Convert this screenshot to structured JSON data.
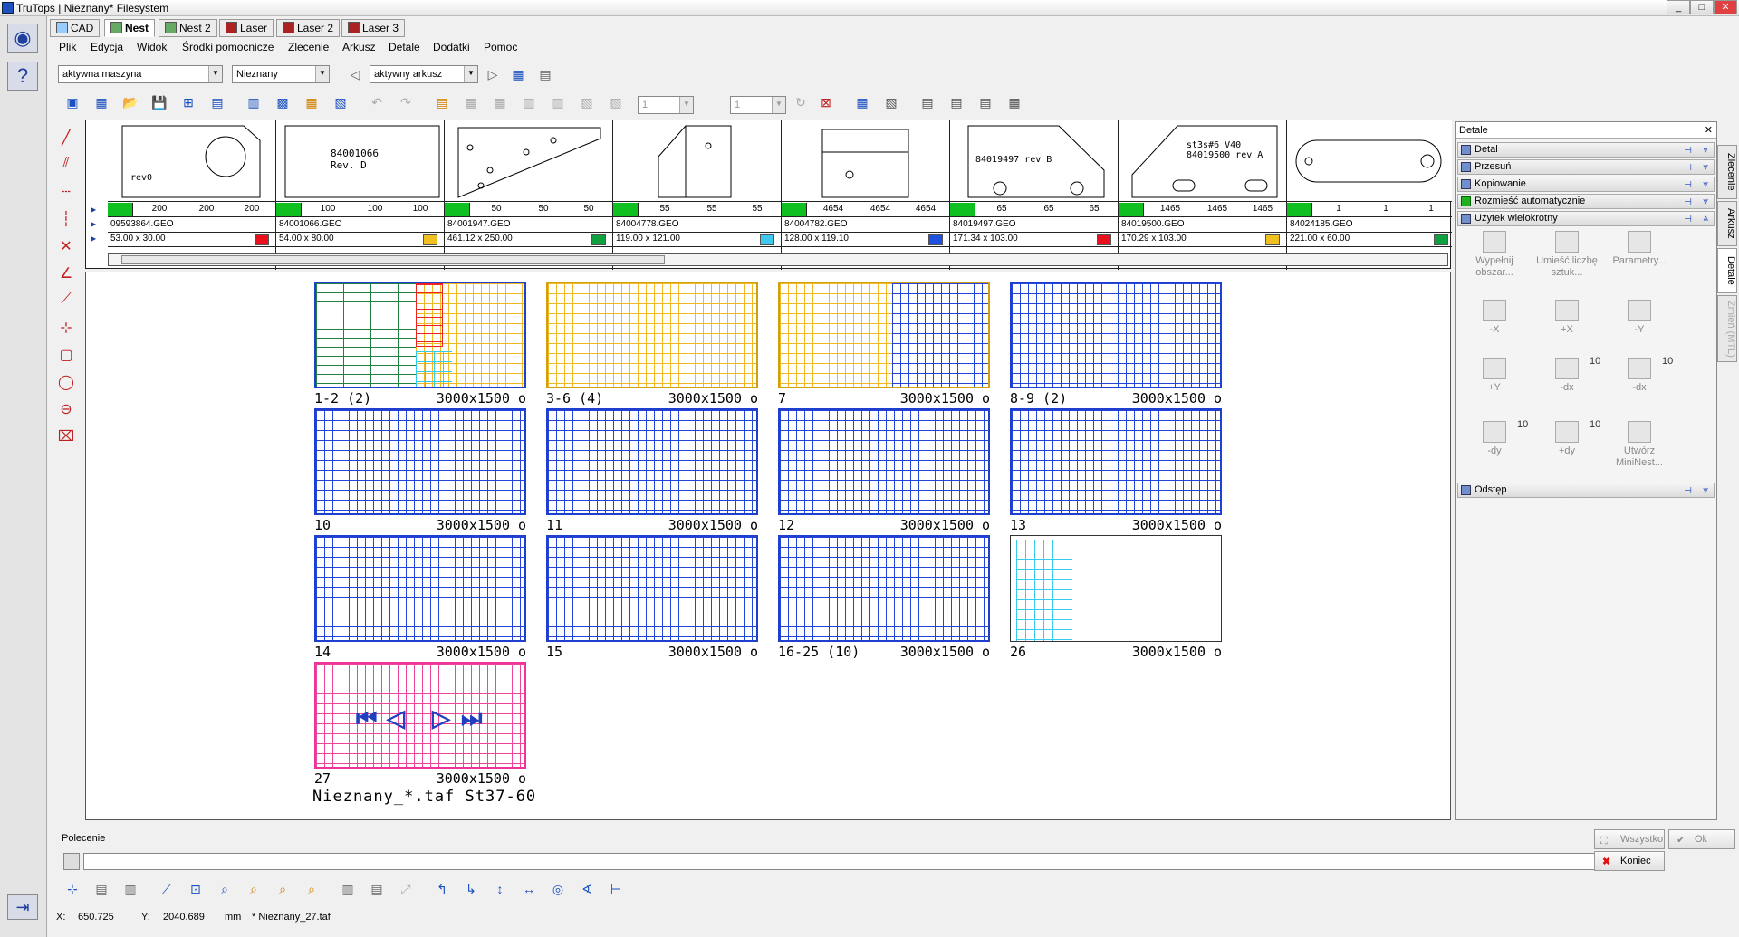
{
  "window": {
    "title": "TruTops | Nieznany*  Filesystem",
    "min": "_",
    "max": "□",
    "close": "✕"
  },
  "tabs": [
    {
      "label": "CAD"
    },
    {
      "label": "Nest"
    },
    {
      "label": "Nest 2"
    },
    {
      "label": "Laser"
    },
    {
      "label": "Laser 2"
    },
    {
      "label": "Laser 3"
    }
  ],
  "menu": [
    "Plik",
    "Edycja",
    "Widok",
    "Środki pomocnicze",
    "Zlecenie",
    "Arkusz",
    "Detale",
    "Dodatki",
    "Pomoc"
  ],
  "combos": {
    "machine": "aktywna maszyna",
    "material": "Nieznany",
    "sheet": "aktywny arkusz",
    "spin1": "1",
    "spin2": "1"
  },
  "parts": [
    {
      "file": "09593864.GEO",
      "dim": "53.00 x 30.00",
      "q": [
        "200",
        "200",
        "200"
      ],
      "color": "#e8101a",
      "text": "rev0"
    },
    {
      "file": "84001066.GEO",
      "dim": "54.00 x 80.00",
      "q": [
        "100",
        "100",
        "100"
      ],
      "color": "#f0c020",
      "text": "84001066 Rev. D"
    },
    {
      "file": "84001947.GEO",
      "dim": "461.12 x 250.00",
      "q": [
        "50",
        "50",
        "50"
      ],
      "color": "#10a040",
      "text": ""
    },
    {
      "file": "84004778.GEO",
      "dim": "119.00 x 121.00",
      "q": [
        "55",
        "55",
        "55"
      ],
      "color": "#40c8f0",
      "text": ""
    },
    {
      "file": "84004782.GEO",
      "dim": "128.00 x 119.10",
      "q": [
        "4654",
        "4654",
        "4654"
      ],
      "color": "#2050e0",
      "text": ""
    },
    {
      "file": "84019497.GEO",
      "dim": "171.34 x 103.00",
      "q": [
        "65",
        "65",
        "65"
      ],
      "color": "#e8101a",
      "text": "84019497 rev B"
    },
    {
      "file": "84019500.GEO",
      "dim": "170.29 x 103.00",
      "q": [
        "1465",
        "1465",
        "1465"
      ],
      "color": "#f0c020",
      "text": "st3s#6 V40  84019500 rev A"
    },
    {
      "file": "84024185.GEO",
      "dim": "221.00 x 60.00",
      "q": [
        "1",
        "1",
        "1"
      ],
      "color": "#10a040",
      "text": ""
    }
  ],
  "sheets": [
    {
      "name": "1-2 (2)",
      "size": "3000x1500",
      "o": "o"
    },
    {
      "name": "3-6 (4)",
      "size": "3000x1500",
      "o": "o"
    },
    {
      "name": "7",
      "size": "3000x1500",
      "o": "o"
    },
    {
      "name": "8-9 (2)",
      "size": "3000x1500",
      "o": "o"
    },
    {
      "name": "10",
      "size": "3000x1500",
      "o": "o"
    },
    {
      "name": "11",
      "size": "3000x1500",
      "o": "o"
    },
    {
      "name": "12",
      "size": "3000x1500",
      "o": "o"
    },
    {
      "name": "13",
      "size": "3000x1500",
      "o": "o"
    },
    {
      "name": "14",
      "size": "3000x1500",
      "o": "o"
    },
    {
      "name": "15",
      "size": "3000x1500",
      "o": "o"
    },
    {
      "name": "16-25 (10)",
      "size": "3000x1500",
      "o": "o"
    },
    {
      "name": "26",
      "size": "3000x1500",
      "o": "o"
    },
    {
      "name": "27",
      "size": "3000x1500",
      "o": "o"
    }
  ],
  "footer_name": "Nieznany_*.taf St37-60",
  "panel": {
    "title": "Detale",
    "close": "✕",
    "sections": [
      "Detal",
      "Przesuń",
      "Kopiowanie",
      "Rozmieść automatycznie",
      "Użytek wielokrotny",
      "Odstęp"
    ],
    "tools": [
      {
        "label": "Wypełnij obszar..."
      },
      {
        "label": "Umieść liczbę sztuk..."
      },
      {
        "label": "Parametry..."
      },
      {
        "label": "-X"
      },
      {
        "label": "+X"
      },
      {
        "label": "-Y"
      },
      {
        "label": "+Y"
      },
      {
        "label": "-dx",
        "count": "10"
      },
      {
        "label": "-dx",
        "count": "10"
      },
      {
        "label": "-dy",
        "count": "10"
      },
      {
        "label": "+dy",
        "count": "10"
      },
      {
        "label": "Utwórz MiniNest..."
      }
    ],
    "vtabs": [
      "Zlecenie",
      "Arkusz",
      "Detale",
      "Zmień (MTL)"
    ]
  },
  "command": {
    "label": "Polecenie",
    "all": "Wszystko",
    "ok": "Ok",
    "end": "Koniec"
  },
  "status": {
    "x_label": "X:",
    "x": "650.725",
    "y_label": "Y:",
    "y": "2040.689",
    "unit": "mm",
    "file": "* Nieznany_27.taf"
  }
}
